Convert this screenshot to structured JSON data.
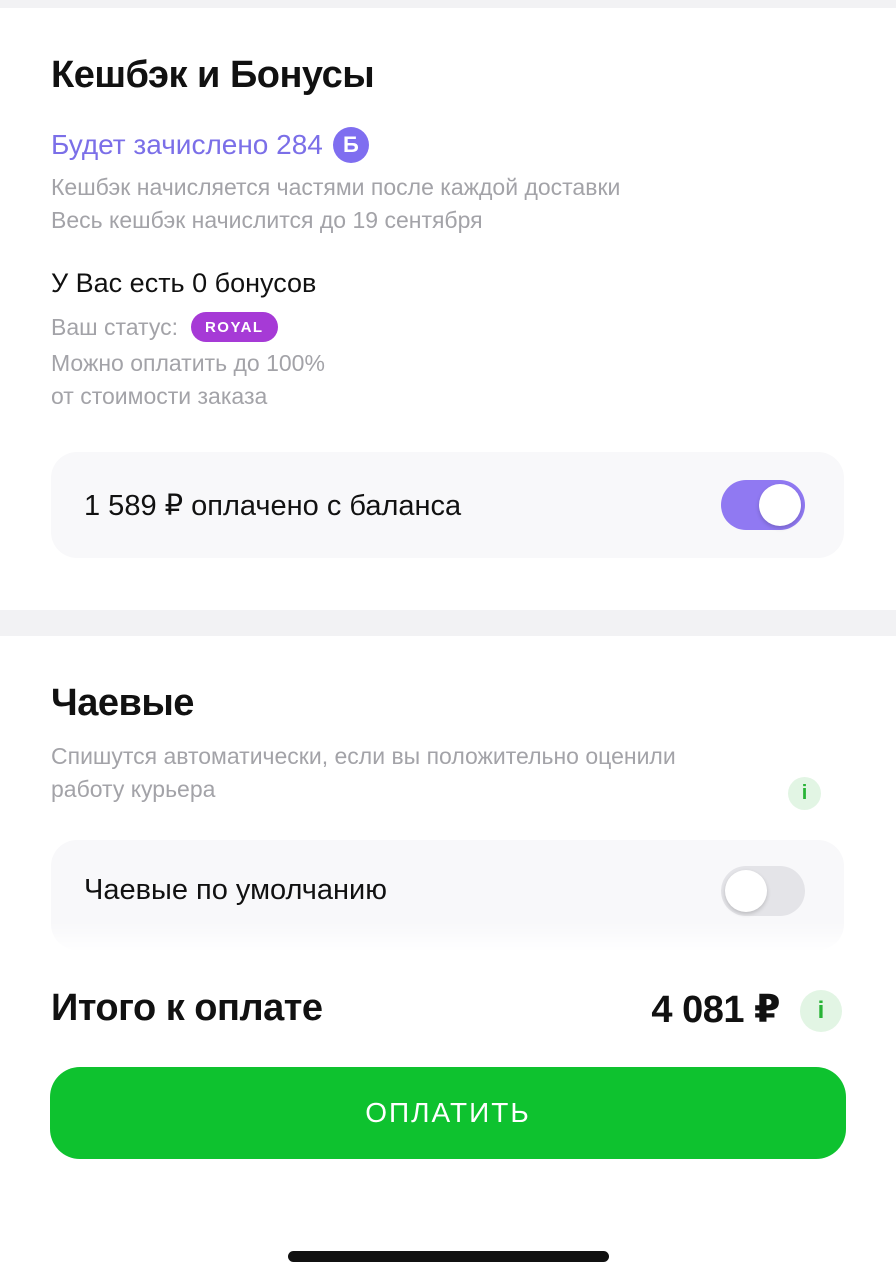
{
  "cashback": {
    "title": "Кешбэк и Бонусы",
    "credited_text": "Будет зачислено 284",
    "bonus_badge": "Б",
    "note_line1": "Кешбэк начисляется частями после каждой доставки",
    "note_line2": "Весь кешбэк начислится до 19 сентября",
    "bonuses_text": "У Вас есть 0 бонусов",
    "status_label": "Ваш статус:",
    "status_badge": "ROYAL",
    "pay_line1": "Можно оплатить до 100%",
    "pay_line2": "от стоимости заказа",
    "balance_toggle_label": "1 589 ₽ оплачено с баланса",
    "balance_toggle_on": true
  },
  "tips": {
    "title": "Чаевые",
    "desc_line1": "Спишутся автоматически, если вы положительно оценили",
    "desc_line2": "работу курьера",
    "info_icon": "i",
    "default_toggle_label": "Чаевые по умолчанию",
    "default_toggle_on": false
  },
  "footer": {
    "total_label": "Итого к оплате",
    "total_amount": "4 081 ₽",
    "info_icon": "i",
    "pay_button_label": "ОПЛАТИТЬ"
  },
  "colors": {
    "accent_purple": "#7b6fe8",
    "toggle_on": "#9079f2",
    "royal_badge": "#a63ad6",
    "pay_green": "#0ec22f",
    "info_green": "#28b336"
  },
  "icons": {
    "bonus": "bonus-b-icon",
    "info": "info-icon",
    "toggle": "toggle-switch"
  }
}
